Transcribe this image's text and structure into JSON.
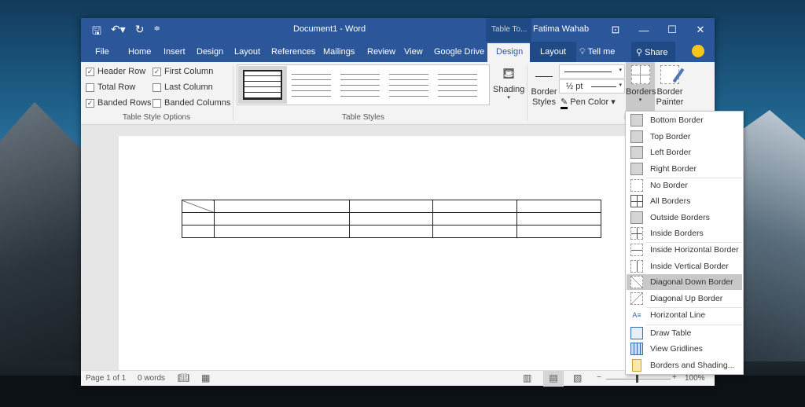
{
  "window": {
    "doc_title": "Document1  -  Word",
    "context_group": "Table To...",
    "user": "Fatima Wahab"
  },
  "quick_access": [
    "save-icon",
    "undo-icon",
    "redo-icon",
    "customize-icon"
  ],
  "tabs": [
    {
      "label": "File"
    },
    {
      "label": "Home"
    },
    {
      "label": "Insert"
    },
    {
      "label": "Design"
    },
    {
      "label": "Layout"
    },
    {
      "label": "References"
    },
    {
      "label": "Mailings"
    },
    {
      "label": "Review"
    },
    {
      "label": "View"
    },
    {
      "label": "Google Drive"
    },
    {
      "label": "Design"
    },
    {
      "label": "Layout"
    }
  ],
  "tell_me": "Tell me",
  "share": "Share",
  "table_style_options": {
    "label": "Table Style Options",
    "items": [
      {
        "label": "Header Row",
        "checked": "✓"
      },
      {
        "label": "First Column",
        "checked": "✓"
      },
      {
        "label": "Total Row",
        "checked": ""
      },
      {
        "label": "Last Column",
        "checked": ""
      },
      {
        "label": "Banded Rows",
        "checked": "✓"
      },
      {
        "label": "Banded Columns",
        "checked": ""
      }
    ]
  },
  "table_styles": {
    "label": "Table Styles",
    "shading": "Shading"
  },
  "borders_group": {
    "label": "Borders",
    "border_styles": "Border Styles",
    "line_weight": "½ pt",
    "pen_color": "Pen Color",
    "borders": "Borders",
    "border_painter": "Border Painter"
  },
  "borders_menu": [
    {
      "label": "Bottom Border"
    },
    {
      "label": "Top Border"
    },
    {
      "label": "Left Border"
    },
    {
      "label": "Right Border"
    },
    {
      "label": "No Border"
    },
    {
      "label": "All Borders"
    },
    {
      "label": "Outside Borders"
    },
    {
      "label": "Inside Borders"
    },
    {
      "label": "Inside Horizontal Border"
    },
    {
      "label": "Inside Vertical Border"
    },
    {
      "label": "Diagonal Down Border"
    },
    {
      "label": "Diagonal Up Border"
    },
    {
      "label": "Horizontal Line"
    },
    {
      "label": "Draw Table"
    },
    {
      "label": "View Gridlines"
    },
    {
      "label": "Borders and Shading..."
    }
  ],
  "status": {
    "page": "Page 1 of 1",
    "words": "0 words",
    "zoom": "100%"
  }
}
